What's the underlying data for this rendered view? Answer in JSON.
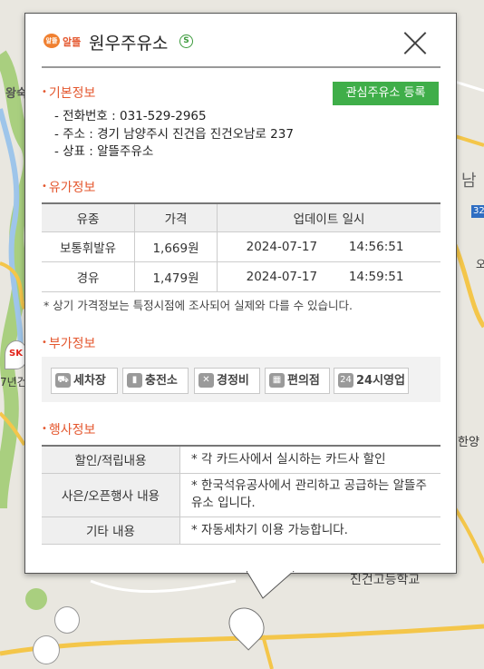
{
  "map": {
    "labels": [
      "왕숙",
      "남",
      "SK",
      "7년건",
      "한양",
      "진건고등학교",
      "오"
    ],
    "road_badge": "32"
  },
  "popup": {
    "brand": "알뜰",
    "brand_logo_text": "알뜰",
    "station_name": "원우주유소",
    "self_badge": "S",
    "register_button": "관심주유소 등록",
    "sections": {
      "basic": "기본정보",
      "fuel": "유가정보",
      "extra": "부가정보",
      "event": "행사정보"
    },
    "basic_info": [
      "- 전화번호 : 031-529-2965",
      "- 주소 : 경기 남양주시 진건읍 진건오남로 237",
      "- 상표 : 알뜰주유소"
    ],
    "price_table": {
      "headers": [
        "유종",
        "가격",
        "업데이트 일시"
      ],
      "rows": [
        {
          "fuel": "보통휘발유",
          "price": "1,669원",
          "date": "2024-07-17",
          "time": "14:56:51"
        },
        {
          "fuel": "경유",
          "price": "1,479원",
          "date": "2024-07-17",
          "time": "14:59:51"
        }
      ]
    },
    "note": "* 상기 가격정보는 특정시점에 조사되어 실제와 다를 수 있습니다.",
    "amenities": [
      {
        "label": "세차장",
        "icon": "car-wash-icon",
        "glyph": "⛟"
      },
      {
        "label": "충전소",
        "icon": "charging-icon",
        "glyph": "▮"
      },
      {
        "label": "경정비",
        "icon": "wrench-icon",
        "glyph": "✕"
      },
      {
        "label": "편의점",
        "icon": "store-icon",
        "glyph": "▦"
      },
      {
        "label": "24시영업",
        "icon": "clock-24-icon",
        "glyph": "24"
      }
    ],
    "event_table": [
      {
        "key": "할인/적립내용",
        "value": "* 각 카드사에서 실시하는 카드사 할인"
      },
      {
        "key": "사은/오픈행사 내용",
        "value": "* 한국석유공사에서 관리하고 공급하는 알뜰주유소 입니다."
      },
      {
        "key": "기타 내용",
        "value": "* 자동세차기 이용 가능합니다."
      }
    ]
  },
  "colors": {
    "accent": "#e4572e",
    "register_button": "#3fae49",
    "self_badge": "#3b9a3b"
  }
}
